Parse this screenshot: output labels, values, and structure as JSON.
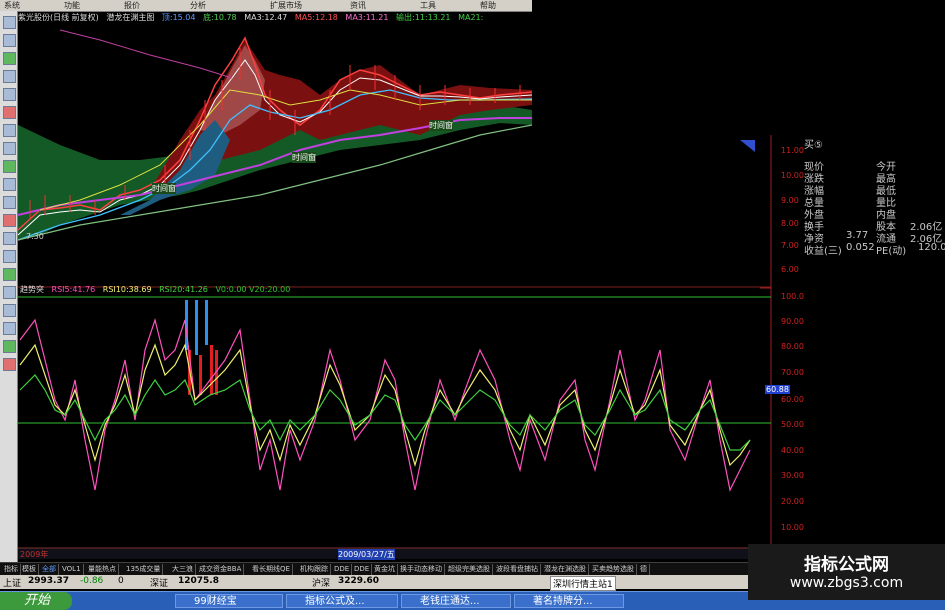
{
  "menu": [
    "系统",
    "功能",
    "报价",
    "分析",
    "扩展市场",
    "资讯",
    "工具",
    "帮助"
  ],
  "top_row": {
    "stock": "紫光股份(日线 前复权)",
    "indicator": "潜龙在渊主图",
    "item1": "顶:15.04",
    "item2": "底:10.78",
    "ma3": "MA3:12.47",
    "ma5": "MA5:12.18",
    "ma_a": "MA3:11.21",
    "out": "输出:11:13.21",
    "ma21": "MA21:"
  },
  "main_chart": {
    "labels": [
      "时间窗",
      "时间窗",
      "时间窗"
    ],
    "low_label": "7.30"
  },
  "right_axis_top": [
    "11.00",
    "10.00",
    "9.00",
    "8.00",
    "7.00",
    "6.00"
  ],
  "quote": {
    "buy5": "买⑤",
    "rows": [
      {
        "l": "现价",
        "r": "今开"
      },
      {
        "l": "涨跌",
        "r": "最高"
      },
      {
        "l": "涨幅",
        "r": "最低"
      },
      {
        "l": "总量",
        "r": "量比"
      },
      {
        "l": "外盘",
        "r": "内盘"
      }
    ],
    "r1": {
      "a": "换手",
      "b": "股本",
      "c": "2.06亿"
    },
    "r2": {
      "a": "净资",
      "v": "3.77",
      "b": "流通",
      "c": "2.06亿"
    },
    "r3": {
      "a": "收益(三)",
      "v": "0.052",
      "b": "PE(动)",
      "c": "120.0"
    }
  },
  "sub_header": {
    "name": "趋势突",
    "rsi5": "RSI5:41.76",
    "rsi10": "RSI10:38.69",
    "rsi20": "RSI20:41.26",
    "v": "V0:0.00  V20:20.00"
  },
  "right_axis_bottom": [
    "100.0",
    "90.00",
    "80.00",
    "70.00",
    "60.00",
    "50.00",
    "40.00",
    "30.00",
    "20.00",
    "10.00"
  ],
  "hl_value": "60.88",
  "date_bar": {
    "year": "2009年",
    "sel": "2009/03/27/五"
  },
  "tabs": [
    "指标",
    "模板",
    "全部",
    "VOL1",
    "量能热点",
    "135成交量",
    "大三浪",
    "成交资金BBA",
    "看长期线QE",
    "机构跟踪",
    "DDE",
    "DDE",
    "黄金坑",
    "换手动态移动",
    "超级完美选股",
    "波段看盘捕钻",
    "潜龙在渊选股",
    "买卖趋势选股",
    "德"
  ],
  "status": {
    "sh": "上证",
    "sh_val": "2993.37",
    "sh_chg": "-0.86",
    "sh_vol": "0",
    "sz": "深证",
    "sz_val": "12075.8",
    "hs": "沪深",
    "hs_val": "3229.60",
    "server": "深圳行情主站1"
  },
  "taskbar": {
    "start": "开始",
    "items": [
      "99财经宝",
      "指标公式及...",
      "老钱庄通达...",
      "著名持牌分..."
    ]
  },
  "watermark": {
    "line1": "指标公式网",
    "line2": "www.zbgs3.com"
  }
}
